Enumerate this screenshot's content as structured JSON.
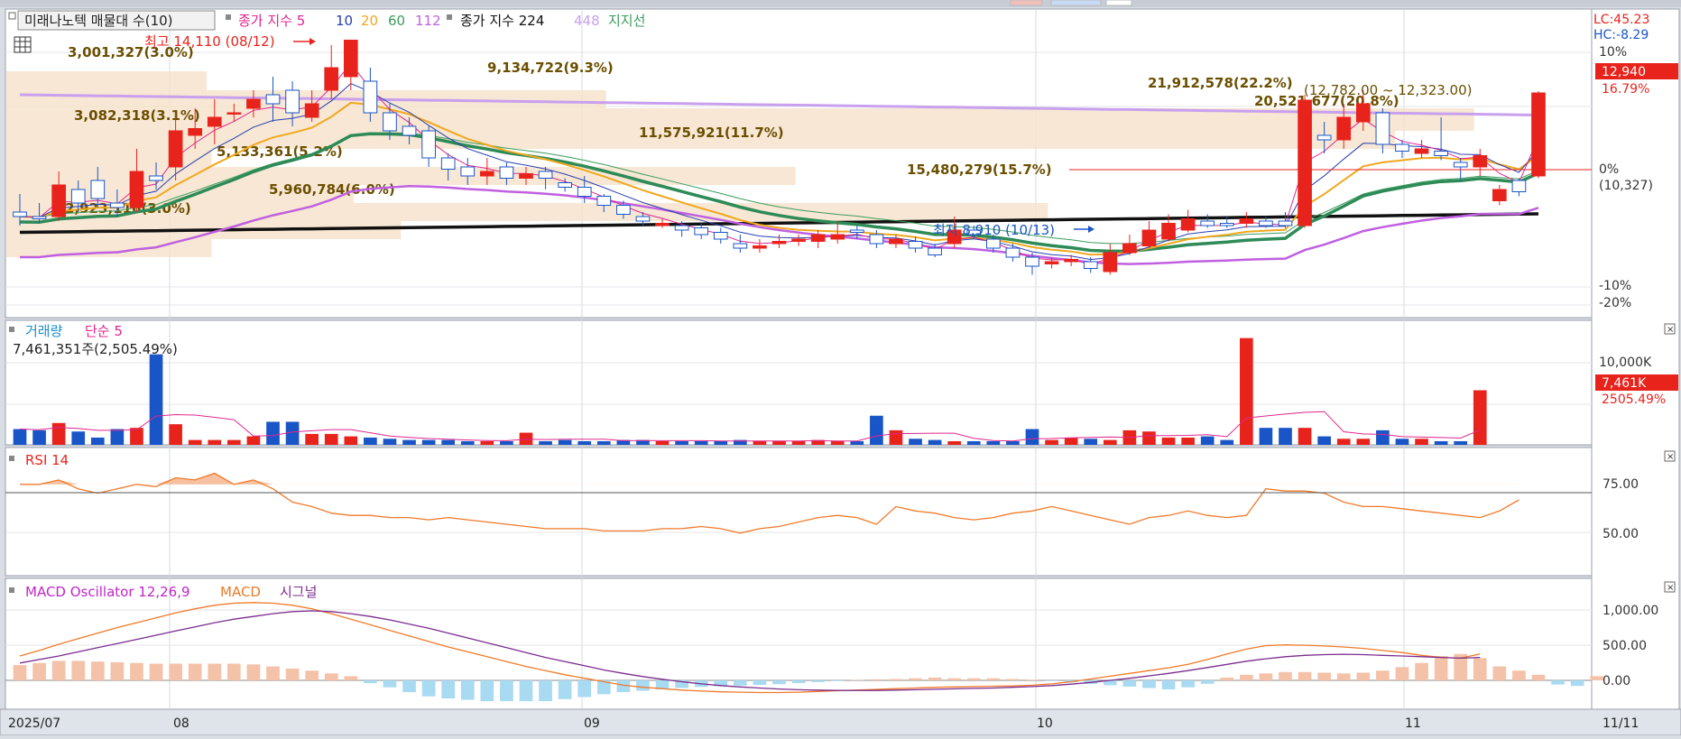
{
  "header": {
    "stock_label": "미래나노텍 매물대 수(10)",
    "ma_prefix": "종가 지수 5",
    "ma_periods": [
      "10",
      "20",
      "60",
      "112"
    ],
    "ma2_prefix": "종가 지수 224",
    "ma2_extra": "448",
    "support_label": "지지선"
  },
  "colors": {
    "up": "#e8231c",
    "down": "#1a55c7",
    "ma5": "#e0268f",
    "ma10": "#2a3fb0",
    "ma20": "#f0a81e",
    "ma60": "#3c9c5c",
    "ma112": "#c060e0",
    "ma224": "#111111",
    "ma448": "#c8a0ee",
    "ma_thick": "#2e8b57",
    "volume_avg": "#e0268f",
    "rsi": "#f07a2a",
    "macd": "#f07a2a",
    "signal": "#7b2c8f",
    "osc_up": "#f4c2a8",
    "osc_down": "#a8daf2"
  },
  "price_panel": {
    "high_label": "최고 14,110 (08/12)",
    "low_label": "최저 8,910 (10/13)",
    "lc_label": "LC:45.23",
    "hc_label": "HC:-8.29",
    "current_price": "12,940",
    "current_change": "16.79%",
    "range_label": "(12,782.00 ~ 12,323.00)",
    "zero_label": "(10,327)",
    "right_axis": [
      "10%",
      "0%",
      "-10%",
      "-20%"
    ],
    "volume_profile": [
      {
        "label": "3,001,327(3.0%)"
      },
      {
        "label": "9,134,722(9.3%)"
      },
      {
        "label": "21,912,578(22.2%)"
      },
      {
        "label": "20,521,677(20.8%)"
      },
      {
        "label": "3,082,318(3.1%)"
      },
      {
        "label": "11,575,921(11.7%)"
      },
      {
        "label": "5,133,361(5.2%)"
      },
      {
        "label": "15,480,279(15.7%)"
      },
      {
        "label": "5,960,784(6.0%)"
      },
      {
        "label": "2,923,116(3.0%)"
      }
    ]
  },
  "volume_panel": {
    "title": "거래량",
    "avg_label": "단순 5",
    "last_volume": "7,461,351주(2,505.49%)",
    "axis_label": "10,000K",
    "current_volume": "7,461K",
    "current_ratio": "2505.49%"
  },
  "rsi_panel": {
    "title": "RSI 14",
    "axis": [
      "75.00",
      "50.00"
    ]
  },
  "macd_panel": {
    "title": "MACD Oscillator 12,26,9",
    "macd_label": "MACD",
    "signal_label": "시그널",
    "axis": [
      "1,000.00",
      "500.00",
      "0.00"
    ]
  },
  "x_axis": {
    "labels": [
      "2025/07",
      "08",
      "09",
      "10",
      "11"
    ],
    "end_label": "11/11"
  },
  "chart_data": {
    "type": "candlestick",
    "candles": [
      {
        "o": 10300,
        "c": 10200,
        "h": 10700,
        "l": 10000
      },
      {
        "o": 10200,
        "c": 10150,
        "h": 10500,
        "l": 10050
      },
      {
        "o": 10200,
        "c": 10900,
        "h": 11200,
        "l": 10100
      },
      {
        "o": 10800,
        "c": 10500,
        "h": 11000,
        "l": 10300
      },
      {
        "o": 11000,
        "c": 10600,
        "h": 11300,
        "l": 10400
      },
      {
        "o": 10500,
        "c": 10400,
        "h": 10800,
        "l": 10200
      },
      {
        "o": 10400,
        "c": 11200,
        "h": 11700,
        "l": 10300
      },
      {
        "o": 11100,
        "c": 11000,
        "h": 11400,
        "l": 10800
      },
      {
        "o": 11300,
        "c": 12100,
        "h": 12500,
        "l": 11000
      },
      {
        "o": 12000,
        "c": 12150,
        "h": 12600,
        "l": 11700
      },
      {
        "o": 12200,
        "c": 12400,
        "h": 12800,
        "l": 11800
      },
      {
        "o": 12500,
        "c": 12500,
        "h": 12700,
        "l": 12300
      },
      {
        "o": 12600,
        "c": 12800,
        "h": 13000,
        "l": 12400
      },
      {
        "o": 12900,
        "c": 12700,
        "h": 13300,
        "l": 12300
      },
      {
        "o": 13000,
        "c": 12500,
        "h": 13200,
        "l": 12200
      },
      {
        "o": 12400,
        "c": 12700,
        "h": 13000,
        "l": 12300
      },
      {
        "o": 13000,
        "c": 13500,
        "h": 14000,
        "l": 12800
      },
      {
        "o": 13300,
        "c": 14110,
        "h": 14110,
        "l": 13000
      },
      {
        "o": 13200,
        "c": 12500,
        "h": 13500,
        "l": 12300
      },
      {
        "o": 12500,
        "c": 12100,
        "h": 12700,
        "l": 11900
      },
      {
        "o": 12200,
        "c": 12000,
        "h": 12400,
        "l": 11800
      },
      {
        "o": 12100,
        "c": 11500,
        "h": 12200,
        "l": 11300
      },
      {
        "o": 11500,
        "c": 11250,
        "h": 11600,
        "l": 11000
      },
      {
        "o": 11300,
        "c": 11100,
        "h": 11500,
        "l": 10900
      },
      {
        "o": 11100,
        "c": 11200,
        "h": 11500,
        "l": 10900
      },
      {
        "o": 11300,
        "c": 11050,
        "h": 11400,
        "l": 10900
      },
      {
        "o": 11050,
        "c": 11150,
        "h": 11300,
        "l": 10900
      },
      {
        "o": 11200,
        "c": 11050,
        "h": 11300,
        "l": 10800
      },
      {
        "o": 10950,
        "c": 10850,
        "h": 11050,
        "l": 10750
      },
      {
        "o": 10850,
        "c": 10650,
        "h": 11100,
        "l": 10500
      },
      {
        "o": 10650,
        "c": 10450,
        "h": 10700,
        "l": 10300
      },
      {
        "o": 10450,
        "c": 10250,
        "h": 10550,
        "l": 10150
      },
      {
        "o": 10200,
        "c": 10100,
        "h": 10300,
        "l": 10000
      },
      {
        "o": 10000,
        "c": 10050,
        "h": 10150,
        "l": 9950
      },
      {
        "o": 10000,
        "c": 9900,
        "h": 10100,
        "l": 9750
      },
      {
        "o": 9950,
        "c": 9800,
        "h": 10050,
        "l": 9700
      },
      {
        "o": 9850,
        "c": 9700,
        "h": 9950,
        "l": 9600
      },
      {
        "o": 9600,
        "c": 9500,
        "h": 9800,
        "l": 9400
      },
      {
        "o": 9500,
        "c": 9550,
        "h": 9700,
        "l": 9400
      },
      {
        "o": 9600,
        "c": 9650,
        "h": 9800,
        "l": 9500
      },
      {
        "o": 9650,
        "c": 9700,
        "h": 9800,
        "l": 9550
      },
      {
        "o": 9650,
        "c": 9800,
        "h": 9900,
        "l": 9500
      },
      {
        "o": 9700,
        "c": 9800,
        "h": 10100,
        "l": 9600
      },
      {
        "o": 9900,
        "c": 9850,
        "h": 10000,
        "l": 9700
      },
      {
        "o": 9800,
        "c": 9600,
        "h": 9900,
        "l": 9500
      },
      {
        "o": 9600,
        "c": 9700,
        "h": 9800,
        "l": 9500
      },
      {
        "o": 9650,
        "c": 9500,
        "h": 9750,
        "l": 9400
      },
      {
        "o": 9500,
        "c": 9350,
        "h": 9600,
        "l": 9300
      },
      {
        "o": 9600,
        "c": 9900,
        "h": 10200,
        "l": 9500
      },
      {
        "o": 9900,
        "c": 9800,
        "h": 10000,
        "l": 9700
      },
      {
        "o": 9700,
        "c": 9500,
        "h": 9800,
        "l": 9400
      },
      {
        "o": 9500,
        "c": 9300,
        "h": 9600,
        "l": 9200
      },
      {
        "o": 9300,
        "c": 9100,
        "h": 9400,
        "l": 8910
      },
      {
        "o": 9150,
        "c": 9200,
        "h": 9300,
        "l": 9050
      },
      {
        "o": 9200,
        "c": 9250,
        "h": 9350,
        "l": 9100
      },
      {
        "o": 9200,
        "c": 9050,
        "h": 9300,
        "l": 8950
      },
      {
        "o": 8980,
        "c": 9400,
        "h": 9600,
        "l": 8910
      },
      {
        "o": 9400,
        "c": 9600,
        "h": 9800,
        "l": 9350
      },
      {
        "o": 9550,
        "c": 9900,
        "h": 10100,
        "l": 9500
      },
      {
        "o": 9700,
        "c": 10050,
        "h": 10250,
        "l": 9650
      },
      {
        "o": 9900,
        "c": 10150,
        "h": 10350,
        "l": 9850
      },
      {
        "o": 10100,
        "c": 10000,
        "h": 10250,
        "l": 9950
      },
      {
        "o": 10050,
        "c": 10000,
        "h": 10200,
        "l": 9950
      },
      {
        "o": 10050,
        "c": 10150,
        "h": 10300,
        "l": 9950
      },
      {
        "o": 10100,
        "c": 10000,
        "h": 10200,
        "l": 9950
      },
      {
        "o": 10100,
        "c": 10000,
        "h": 10300,
        "l": 9950
      },
      {
        "o": 10000,
        "c": 12780,
        "h": 12900,
        "l": 9950
      },
      {
        "o": 12000,
        "c": 11900,
        "h": 12300,
        "l": 11600
      },
      {
        "o": 11900,
        "c": 12400,
        "h": 12700,
        "l": 11700
      },
      {
        "o": 12300,
        "c": 12700,
        "h": 13000,
        "l": 12100
      },
      {
        "o": 12500,
        "c": 11800,
        "h": 12600,
        "l": 11600
      },
      {
        "o": 11800,
        "c": 11650,
        "h": 11900,
        "l": 11500
      },
      {
        "o": 11600,
        "c": 11700,
        "h": 11900,
        "l": 11500
      },
      {
        "o": 11650,
        "c": 11550,
        "h": 12400,
        "l": 11450
      },
      {
        "o": 11400,
        "c": 11300,
        "h": 11500,
        "l": 11000
      },
      {
        "o": 11300,
        "c": 11550,
        "h": 11700,
        "l": 11100
      },
      {
        "o": 10550,
        "c": 10800,
        "h": 10900,
        "l": 10450
      },
      {
        "o": 11000,
        "c": 10750,
        "h": 11050,
        "l": 10650
      },
      {
        "o": 11100,
        "c": 12940,
        "h": 12980,
        "l": 11050
      }
    ],
    "volumes": [
      1300,
      1200,
      1800,
      1100,
      600,
      1300,
      1400,
      7461,
      1700,
      400,
      400,
      400,
      700,
      1900,
      1900,
      900,
      900,
      700,
      600,
      500,
      400,
      400,
      400,
      300,
      300,
      300,
      1000,
      300,
      400,
      300,
      300,
      400,
      400,
      300,
      300,
      300,
      300,
      400,
      300,
      300,
      300,
      400,
      300,
      300,
      2400,
      1200,
      500,
      400,
      300,
      300,
      300,
      300,
      1300,
      400,
      600,
      500,
      400,
      1200,
      1100,
      600,
      600,
      700,
      400,
      8800,
      1400,
      1400,
      1400,
      700,
      500,
      500,
      1200,
      500,
      500,
      300,
      300,
      4500
    ],
    "rsi": [
      70,
      70,
      72,
      68,
      66,
      68,
      70,
      69,
      73,
      72,
      75,
      70,
      72,
      68,
      62,
      60,
      57,
      56,
      56,
      55,
      55,
      54,
      55,
      54,
      53,
      52,
      51,
      50,
      50,
      50,
      49,
      49,
      49,
      50,
      50,
      51,
      50,
      48,
      50,
      51,
      53,
      55,
      56,
      55,
      52,
      60,
      58,
      57,
      55,
      54,
      55,
      57,
      58,
      60,
      58,
      56,
      54,
      52,
      55,
      56,
      58,
      56,
      55,
      56,
      68,
      67,
      67,
      66,
      62,
      60,
      60,
      59,
      58,
      57,
      56,
      55,
      58,
      63
    ],
    "macd": [
      350,
      430,
      520,
      600,
      680,
      760,
      830,
      900,
      970,
      1030,
      1080,
      1110,
      1120,
      1110,
      1080,
      1030,
      960,
      880,
      800,
      720,
      640,
      560,
      480,
      410,
      340,
      270,
      200,
      140,
      80,
      30,
      -20,
      -70,
      -100,
      -120,
      -140,
      -155,
      -165,
      -170,
      -175,
      -175,
      -170,
      -160,
      -150,
      -140,
      -130,
      -120,
      -110,
      -100,
      -95,
      -90,
      -85,
      -80,
      -70,
      -50,
      -20,
      20,
      60,
      100,
      140,
      180,
      230,
      300,
      380,
      450,
      500,
      510,
      505,
      495,
      480,
      460,
      430,
      400,
      360,
      330,
      320,
      380
    ],
    "signal": [
      250,
      300,
      350,
      410,
      470,
      530,
      590,
      650,
      710,
      770,
      830,
      880,
      920,
      960,
      990,
      1000,
      990,
      960,
      920,
      870,
      810,
      750,
      680,
      610,
      540,
      470,
      400,
      330,
      270,
      210,
      150,
      100,
      55,
      15,
      -20,
      -50,
      -75,
      -95,
      -110,
      -125,
      -135,
      -140,
      -145,
      -145,
      -145,
      -140,
      -135,
      -128,
      -122,
      -115,
      -110,
      -100,
      -90,
      -75,
      -55,
      -30,
      0,
      30,
      65,
      100,
      140,
      185,
      230,
      275,
      310,
      340,
      360,
      370,
      375,
      370,
      360,
      350,
      340,
      330,
      320,
      330
    ],
    "osc": [
      220,
      250,
      280,
      280,
      270,
      260,
      250,
      240,
      240,
      240,
      240,
      240,
      230,
      200,
      170,
      140,
      100,
      60,
      -40,
      -100,
      -170,
      -230,
      -260,
      -280,
      -300,
      -300,
      -300,
      -300,
      -270,
      -240,
      -200,
      -170,
      -150,
      -130,
      -110,
      -95,
      -85,
      -75,
      -65,
      -55,
      -40,
      -25,
      -10,
      5,
      15,
      20,
      30,
      40,
      30,
      30,
      30,
      20,
      10,
      -10,
      -30,
      -50,
      -70,
      -90,
      -110,
      -130,
      -100,
      -50,
      40,
      80,
      100,
      120,
      120,
      110,
      100,
      110,
      140,
      190,
      250,
      350,
      380,
      320,
      200,
      140,
      80,
      -60,
      -80,
      60
    ]
  }
}
